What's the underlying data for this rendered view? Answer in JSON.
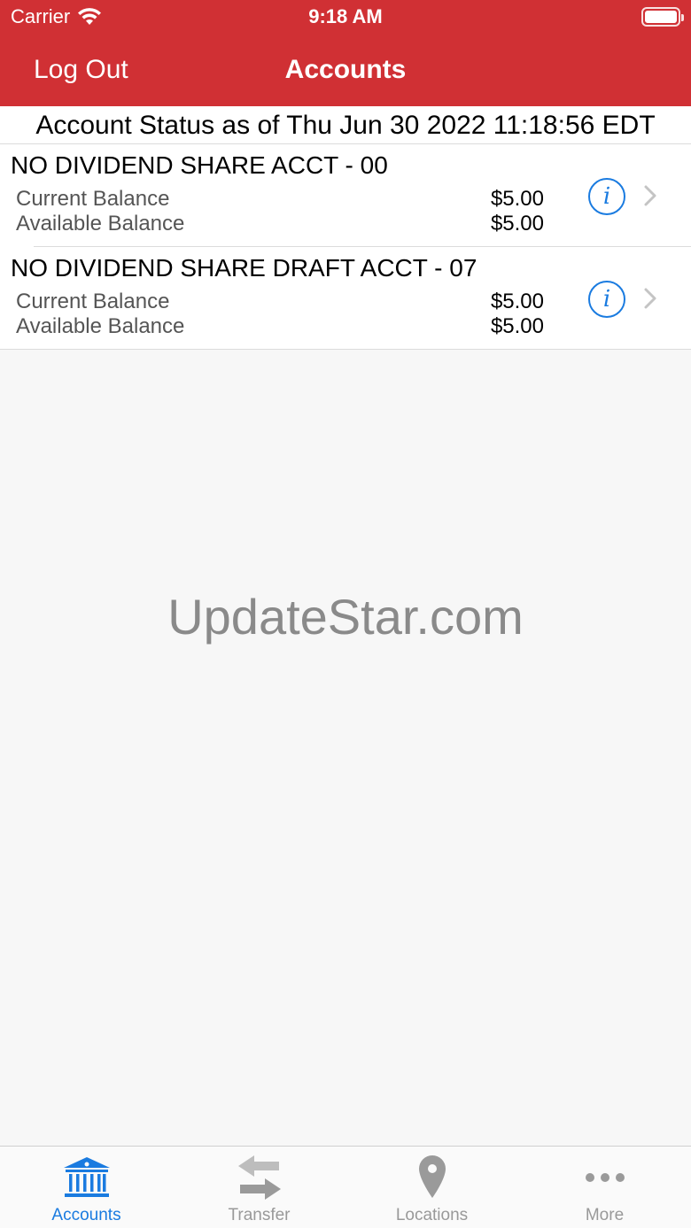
{
  "status_bar": {
    "carrier": "Carrier",
    "time": "9:18 AM"
  },
  "nav": {
    "left_button": "Log Out",
    "title": "Accounts"
  },
  "status_header": "Account Status as of Thu Jun 30 2022 11:18:56 EDT",
  "accounts": [
    {
      "name": "NO DIVIDEND SHARE ACCT - 00",
      "current_label": "Current Balance",
      "current_value": "$5.00",
      "available_label": "Available Balance",
      "available_value": "$5.00"
    },
    {
      "name": "NO DIVIDEND SHARE DRAFT ACCT - 07",
      "current_label": "Current Balance",
      "current_value": "$5.00",
      "available_label": "Available Balance",
      "available_value": "$5.00"
    }
  ],
  "watermark": "UpdateStar.com",
  "tabs": [
    {
      "label": "Accounts",
      "icon": "bank-icon",
      "active": true
    },
    {
      "label": "Transfer",
      "icon": "transfer-icon",
      "active": false
    },
    {
      "label": "Locations",
      "icon": "location-pin-icon",
      "active": false
    },
    {
      "label": "More",
      "icon": "more-dots-icon",
      "active": false
    }
  ],
  "colors": {
    "header_red": "#d03034",
    "accent_blue": "#1a7be0",
    "inactive_gray": "#999999"
  }
}
